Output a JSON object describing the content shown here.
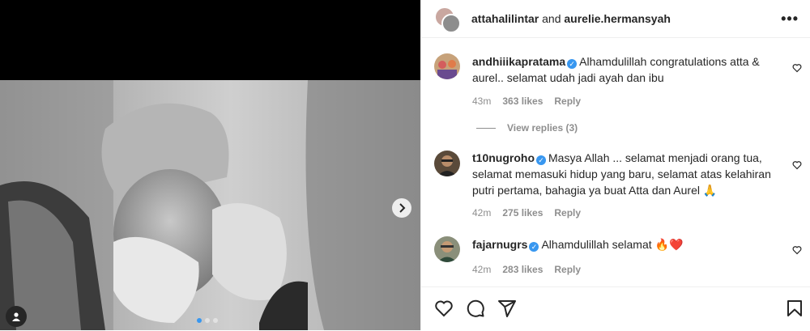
{
  "post": {
    "authors_text": "attahalilintar",
    "and_text": "and",
    "coauthor": "aurelie.hermansyah",
    "more_label": "•••"
  },
  "comments": [
    {
      "username": "andhiiikapratama",
      "text": "Alhamdulillah congratulations atta & aurel.. selamat udah jadi ayah dan ibu",
      "time": "43m",
      "likes": "363 likes",
      "reply": "Reply",
      "view_replies": "View replies (3)"
    },
    {
      "username": "t10nugroho",
      "text": "Masya Allah ... selamat menjadi orang tua, selamat memasuki hidup yang baru, selamat atas kelahiran putri pertama, bahagia ya buat Atta dan Aurel 🙏",
      "time": "42m",
      "likes": "275 likes",
      "reply": "Reply"
    },
    {
      "username": "fajarnugrs",
      "text": "Alhamdulillah selamat 🔥❤️",
      "time": "42m",
      "likes": "283 likes",
      "reply": "Reply"
    }
  ],
  "carousel": {
    "total": 3,
    "current": 1
  },
  "icons": {
    "like": "heart-icon",
    "comment": "comment-icon",
    "share": "share-icon",
    "save": "bookmark-icon",
    "next": "chevron-right-icon",
    "tag": "user-tag-icon"
  },
  "colors": {
    "verified": "#3897f0",
    "muted": "#8e8e8e",
    "text": "#262626"
  }
}
